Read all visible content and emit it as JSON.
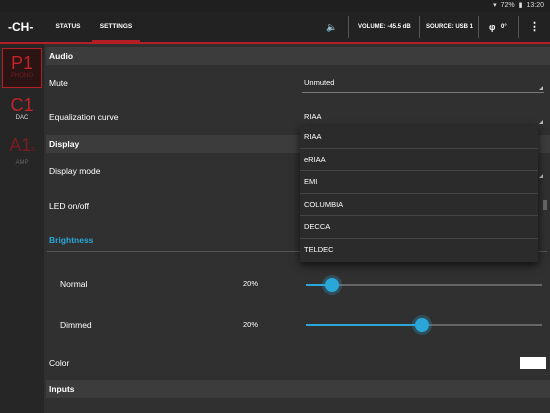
{
  "status_bar": {
    "battery": "72%",
    "time": "13:20"
  },
  "app": {
    "logo": "-CH-"
  },
  "tabs": [
    {
      "label": "STATUS"
    },
    {
      "label": "SETTINGS"
    }
  ],
  "appbar": {
    "volume": "VOLUME: -45.5 dB",
    "source": "SOURCE: USB 1",
    "phase": "0°"
  },
  "devices": [
    {
      "code": "P1",
      "sub": "PHONO",
      "subscript": ""
    },
    {
      "code": "C1",
      "sub": "DAC",
      "subscript": ""
    },
    {
      "code": "A1",
      "sub": "AMP",
      "subscript": "s"
    }
  ],
  "audio": {
    "title": "Audio",
    "mute_label": "Mute",
    "mute_value": "Unmuted",
    "eq_label": "Equalization curve",
    "eq_value": "RIAA"
  },
  "display": {
    "title": "Display",
    "mode_label": "Display mode",
    "led_label": "LED on/off",
    "brightness_title": "Brightness",
    "normal_label": "Normal",
    "normal_value": "20%",
    "normal_level": 0.11,
    "dimmed_label": "Dimmed",
    "dimmed_value": "20%",
    "dimmed_level": 0.49,
    "color_label": "Color",
    "color_value": "#ffffff"
  },
  "inputs": {
    "title": "Inputs"
  },
  "eq_options": [
    "RIAA",
    "eRIAA",
    "EMI",
    "COLUMBIA",
    "DECCA",
    "TELDEC"
  ],
  "colors": {
    "accent": "#b31f24",
    "highlight": "#2aa7d8",
    "device_red": "#c0232a"
  }
}
